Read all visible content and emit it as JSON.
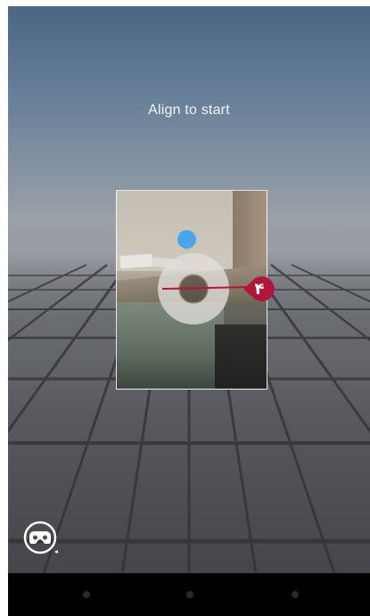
{
  "prompt": {
    "text": "Align to start"
  },
  "marker": {
    "label": "۴"
  },
  "colors": {
    "target_dot": "#4aa6e6",
    "marker": "#b0153a",
    "navbar": "#000000"
  },
  "icons": {
    "marker": "location-pin-icon",
    "cardboard": "cardboard-viewer-icon",
    "nav": [
      "nav-back-icon",
      "nav-home-icon",
      "nav-recents-icon"
    ]
  }
}
